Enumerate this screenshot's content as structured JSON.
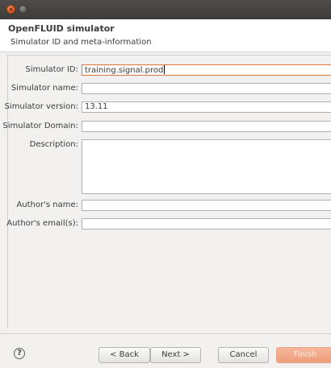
{
  "window": {
    "close_icon": "close-icon",
    "minimize_icon": "minimize-icon"
  },
  "header": {
    "title": "OpenFLUID simulator",
    "subtitle": "Simulator ID and meta-information"
  },
  "form": {
    "simulator_id": {
      "label": "Simulator ID:",
      "value": "training.signal.prod"
    },
    "simulator_name": {
      "label": "Simulator name:",
      "value": ""
    },
    "simulator_version": {
      "label": "Simulator version:",
      "value": "13.11"
    },
    "simulator_domain": {
      "label": "Simulator Domain:",
      "value": ""
    },
    "description": {
      "label": "Description:",
      "value": ""
    },
    "author_name": {
      "label": "Author's name:",
      "value": ""
    },
    "author_email": {
      "label": "Author's email(s):",
      "value": ""
    }
  },
  "footer": {
    "help_symbol": "?",
    "back_label": "< Back",
    "next_label": "Next >",
    "cancel_label": "Cancel",
    "finish_label": "Finish"
  }
}
